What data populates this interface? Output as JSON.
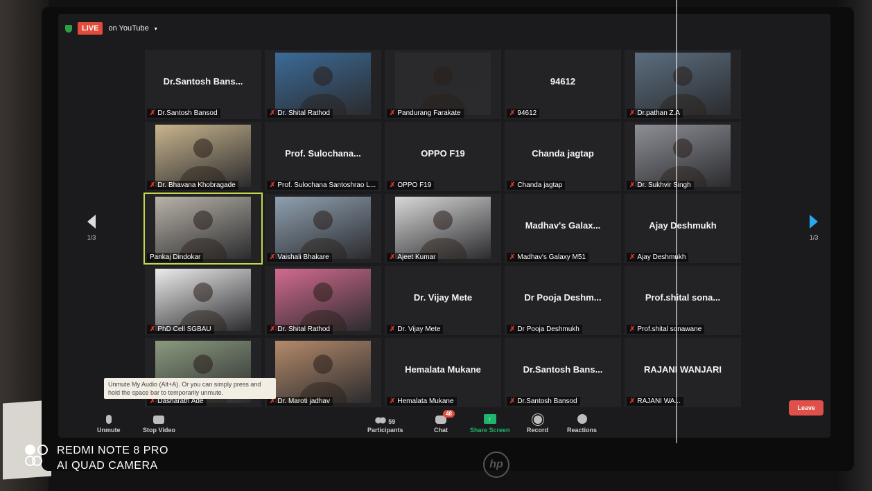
{
  "topbar": {
    "live_label": "LIVE",
    "stream_label": "on YouTube",
    "caret": "▾"
  },
  "pagination": {
    "prev_page": "1/3",
    "next_page": "1/3"
  },
  "tiles": [
    {
      "title": "Dr.Santosh Bans...",
      "name": "Dr.Santosh Bansod",
      "has_video": false
    },
    {
      "title": "",
      "name": "Dr. Shital Rathod",
      "has_video": true,
      "video_color": "#3b6b97"
    },
    {
      "title": "",
      "name": "Pandurang Farakate",
      "has_video": true,
      "video_color": "#2a2a2c"
    },
    {
      "title": "94612",
      "name": "94612",
      "has_video": false
    },
    {
      "title": "",
      "name": "Dr.pathan Z.A",
      "has_video": true,
      "video_color": "#5b6e7f"
    },
    {
      "title": "",
      "name": "Dr. Bhavana Khobragade",
      "has_video": true,
      "video_color": "#c8b58d"
    },
    {
      "title": "Prof. Sulochana...",
      "name": "Prof. Sulochana Santoshrao L...",
      "has_video": false
    },
    {
      "title": "OPPO F19",
      "name": "OPPO F19",
      "has_video": false
    },
    {
      "title": "Chanda jagtap",
      "name": "Chanda jagtap",
      "has_video": false
    },
    {
      "title": "",
      "name": "Dr. Sukhvir Singh",
      "has_video": true,
      "video_color": "#8c8f95"
    },
    {
      "title": "",
      "name": "Pankaj Dindokar",
      "has_video": true,
      "video_color": "#b8b3a8"
    },
    {
      "title": "",
      "name": "Vaishali Bhakare",
      "has_video": true,
      "video_color": "#8fa0b0"
    },
    {
      "title": "",
      "name": "Ajeet Kumar",
      "has_video": true,
      "video_color": "#d8d8d8"
    },
    {
      "title": "Madhav's Galax...",
      "name": "Madhav's Galaxy M51",
      "has_video": false
    },
    {
      "title": "Ajay Deshmukh",
      "name": "Ajay Deshmukh",
      "has_video": false
    },
    {
      "title": "",
      "name": "PhD Cell SGBAU",
      "has_video": true,
      "video_color": "#ececec"
    },
    {
      "title": "",
      "name": "Dr. Shital Rathod",
      "has_video": true,
      "video_color": "#d26a8e"
    },
    {
      "title": "Dr. Vijay Mete",
      "name": "Dr. Vijay Mete",
      "has_video": false
    },
    {
      "title": "Dr Pooja Deshm...",
      "name": "Dr Pooja Deshmukh",
      "has_video": false
    },
    {
      "title": "Prof.shital sona...",
      "name": "Prof.shital sonawane",
      "has_video": false
    },
    {
      "title": "",
      "name": "Dasharath Ade",
      "has_video": true,
      "video_color": "#8a9a7e"
    },
    {
      "title": "",
      "name": "Dr. Maroti jadhav",
      "has_video": true,
      "video_color": "#b48a6a"
    },
    {
      "title": "Hemalata Mukane",
      "name": "Hemalata Mukane",
      "has_video": false
    },
    {
      "title": "Dr.Santosh Bans...",
      "name": "Dr.Santosh Bansod",
      "has_video": false
    },
    {
      "title": "RAJANI WANJARI",
      "name": "RAJANI WA...",
      "has_video": false
    }
  ],
  "toolbar": {
    "unmute_label": "Unmute",
    "stop_video_label": "Stop Video",
    "participants_label": "Participants",
    "participants_count": "59",
    "chat_label": "Chat",
    "chat_badge": "48",
    "share_label": "Share Screen",
    "record_label": "Record",
    "reactions_label": "Reactions",
    "leave_label": "Leave",
    "tooltip": "Unmute My Audio (Alt+A). Or you can simply press and hold the space bar to temporarily unmute."
  },
  "watermark": {
    "line1": "REDMI NOTE 8 PRO",
    "line2": "AI QUAD CAMERA"
  },
  "colors": {
    "live": "#e24b3a",
    "muted": "#e5392d",
    "share": "#1fb56b",
    "nav_next": "#2ba7ec",
    "active_border": "#c6d84a"
  }
}
